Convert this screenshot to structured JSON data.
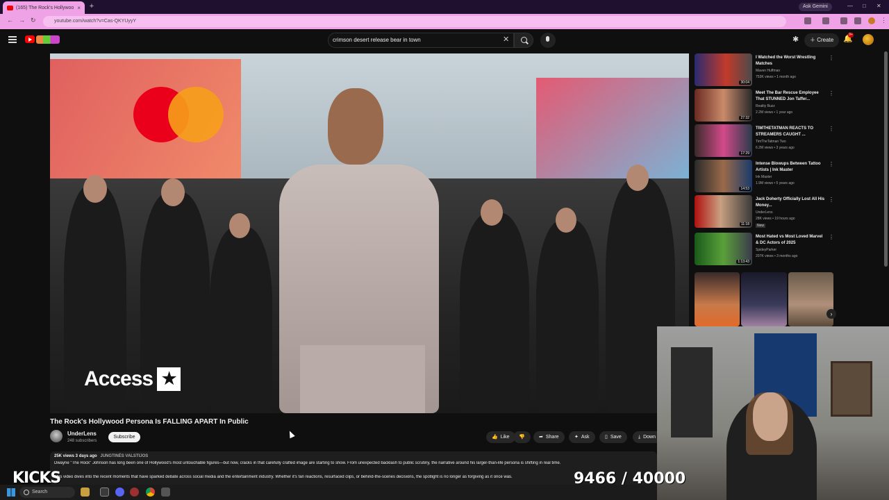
{
  "browser": {
    "tab_title": "(165) The Rock's Hollywoo",
    "address": "youtube.com/watch?v=Cas-QKYUyyY",
    "ask_gemini": "Ask Gemini"
  },
  "header": {
    "search_query": "crimson desert release bear in town",
    "create_label": "Create",
    "notif_count": "9+"
  },
  "video": {
    "title": "The Rock's Hollywood Persona Is FALLING APART In Public",
    "watermark": "Access"
  },
  "channel": {
    "name": "UnderLens",
    "subs": "248 subscribers",
    "subscribe_label": "Subscribe"
  },
  "actions": {
    "like": "Like",
    "share": "Share",
    "ask": "Ask",
    "save": "Save",
    "download": "Down"
  },
  "description": {
    "meta": "25K views  3 days ago",
    "tag": "JUNGTINĖS VALSTIJOS",
    "line1": "Dwayne \"The Rock\" Johnson has long been one of Hollywood's most untouchable figures—but now, cracks in that carefully crafted image are starting to show. From unexpected backlash to public scrutiny, the narrative around his larger-than-life persona is shifting in real time.",
    "line2": "This video dives into the recent moments that have sparked debate across social media and the entertainment industry. Whether it's fan reactions, resurfaced clips, or behind-the-scenes decisions, the spotlight is no longer as forgiving as it once was."
  },
  "recommendations": [
    {
      "title": "I Watched the Worst Wrestling Matches",
      "channel": "Maven Huffman",
      "meta": "753K views • 1 month ago",
      "duration": "30:04",
      "badge": ""
    },
    {
      "title": "Meet The Bar Rescue Employee That STUNNED Jon Taffer...",
      "channel": "Reality Buzz",
      "meta": "2.2M views • 1 year ago",
      "duration": "27:32",
      "badge": ""
    },
    {
      "title": "TIMTHETATMAN REACTS TO STREAMERS CAUGHT ...",
      "channel": "TimTheTatman Two",
      "meta": "6.2M views • 3 years ago",
      "duration": "17:29",
      "badge": ""
    },
    {
      "title": "Intense Blowups Between Tattoo Artists | Ink Master",
      "channel": "Ink Master",
      "meta": "1.9M views • 5 years ago",
      "duration": "14:53",
      "badge": ""
    },
    {
      "title": "Jack Doherty Officially Lost All His Money...",
      "channel": "UnderLens",
      "meta": "28K views • 19 hours ago",
      "duration": "11:18",
      "badge": "New"
    },
    {
      "title": "Most Hated vs Most Loved Marvel & DC Actors of 2025",
      "channel": "SpideyParker",
      "meta": "207K views • 3 months ago",
      "duration": "1:13:43",
      "badge": ""
    }
  ],
  "overlay": {
    "kicks": "KICKS",
    "counter": "9466 / 40000"
  },
  "taskbar": {
    "search": "Search"
  },
  "colors": {
    "accent_pink": "#f0a2e6",
    "yt_red": "#ff0000"
  }
}
